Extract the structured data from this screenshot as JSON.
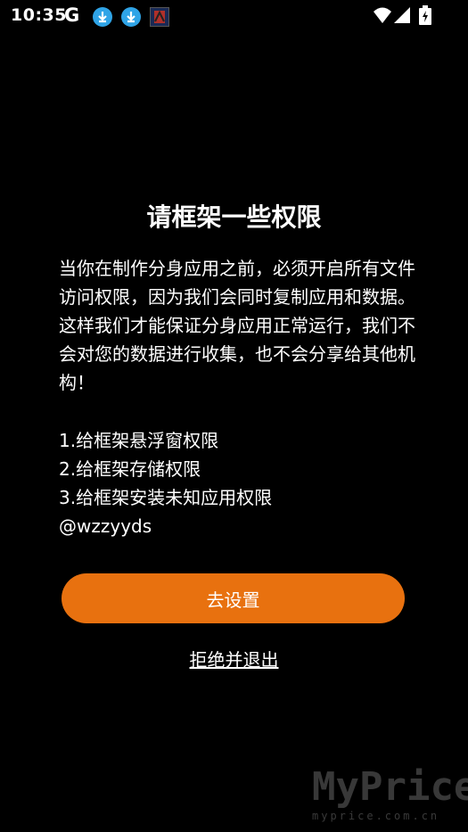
{
  "status_bar": {
    "time": "10:35",
    "google": "G"
  },
  "dialog": {
    "title": "请框架一些权限",
    "description": "当你在制作分身应用之前，必须开启所有文件访问权限，因为我们会同时复制应用和数据。这样我们才能保证分身应用正常运行，我们不会对您的数据进行收集，也不会分享给其他机构！",
    "permissions": [
      "1.给框架悬浮窗权限",
      "2.给框架存储权限",
      "3.给框架安装未知应用权限"
    ],
    "author": "@wzzyyds",
    "primary_button": "去设置",
    "exit_link": "拒绝并退出",
    "accent_color": "#e8710f"
  },
  "watermark": {
    "brand": "MyPrice",
    "url": "myprice.com.cn"
  }
}
